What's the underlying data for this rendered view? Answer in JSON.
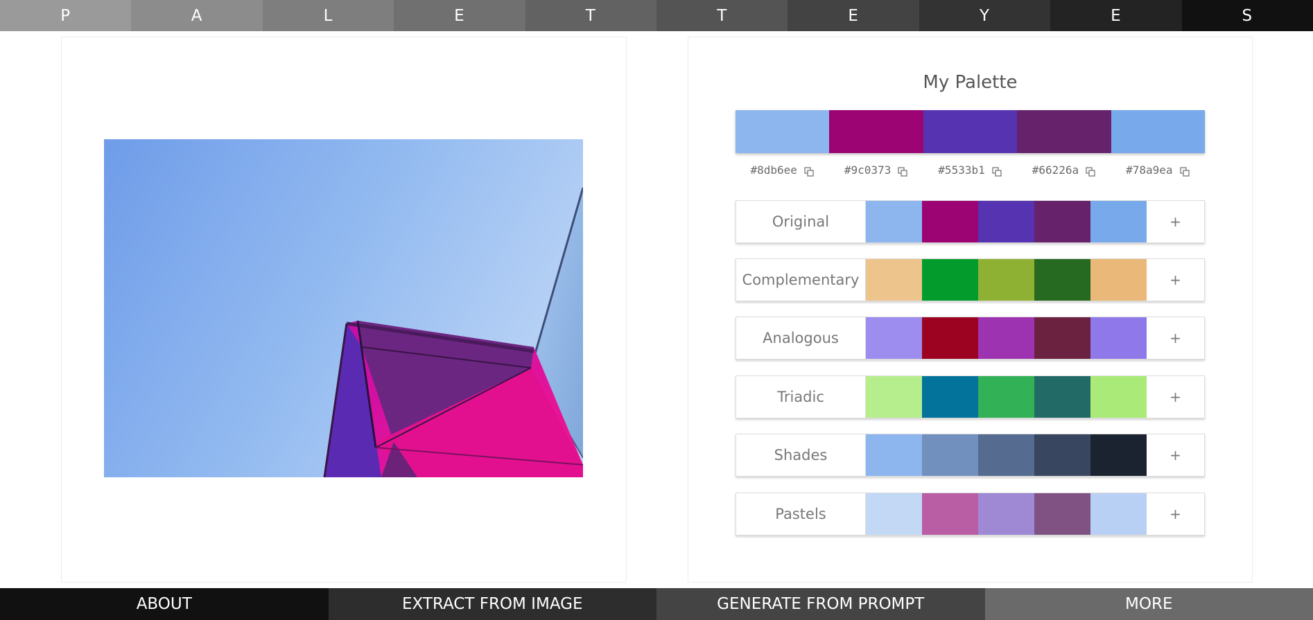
{
  "header": {
    "letters": [
      "P",
      "A",
      "L",
      "E",
      "T",
      "T",
      "E",
      "Y",
      "E",
      "S"
    ],
    "letter_backgrounds": [
      "#9a9a9a",
      "#8c8c8c",
      "#7e7e7e",
      "#707070",
      "#626262",
      "#545454",
      "#434343",
      "#333333",
      "#232323",
      "#111111"
    ]
  },
  "palette": {
    "title": "My Palette",
    "colors": [
      "#8db6ee",
      "#9c0373",
      "#5533b1",
      "#66226a",
      "#78a9ea"
    ],
    "hex_labels": [
      "#8db6ee",
      "#9c0373",
      "#5533b1",
      "#66226a",
      "#78a9ea"
    ],
    "copy_icon": "copy-icon"
  },
  "schemes": [
    {
      "label": "Original",
      "colors": [
        "#8db6ee",
        "#9c0373",
        "#5533b1",
        "#66226a",
        "#78a9ea"
      ],
      "add_label": "+"
    },
    {
      "label": "Complementary",
      "colors": [
        "#eec48d",
        "#039c2c",
        "#8fb133",
        "#266a22",
        "#eab878"
      ],
      "add_label": "+"
    },
    {
      "label": "Analogous",
      "colors": [
        "#9d8dee",
        "#9c0320",
        "#9e33b1",
        "#6a2240",
        "#8e78ea"
      ],
      "add_label": "+"
    },
    {
      "label": "Triadic",
      "colors": [
        "#b6ee8d",
        "#03739c",
        "#33b157",
        "#226a66",
        "#a9ea78"
      ],
      "add_label": "+"
    },
    {
      "label": "Shades",
      "colors": [
        "#8db6ee",
        "#7190be",
        "#556b8f",
        "#38465f",
        "#1c2330"
      ],
      "add_label": "+"
    },
    {
      "label": "Pastels",
      "colors": [
        "#c3d8f5",
        "#b95ea4",
        "#9f88d4",
        "#7f5283",
        "#b8d0f4"
      ],
      "add_label": "+"
    }
  ],
  "nav": {
    "items": [
      "ABOUT",
      "EXTRACT FROM IMAGE",
      "GENERATE FROM PROMPT",
      "MORE"
    ],
    "backgrounds": [
      "#111111",
      "#2d2d2d",
      "#444444",
      "#6a6a6a"
    ]
  }
}
